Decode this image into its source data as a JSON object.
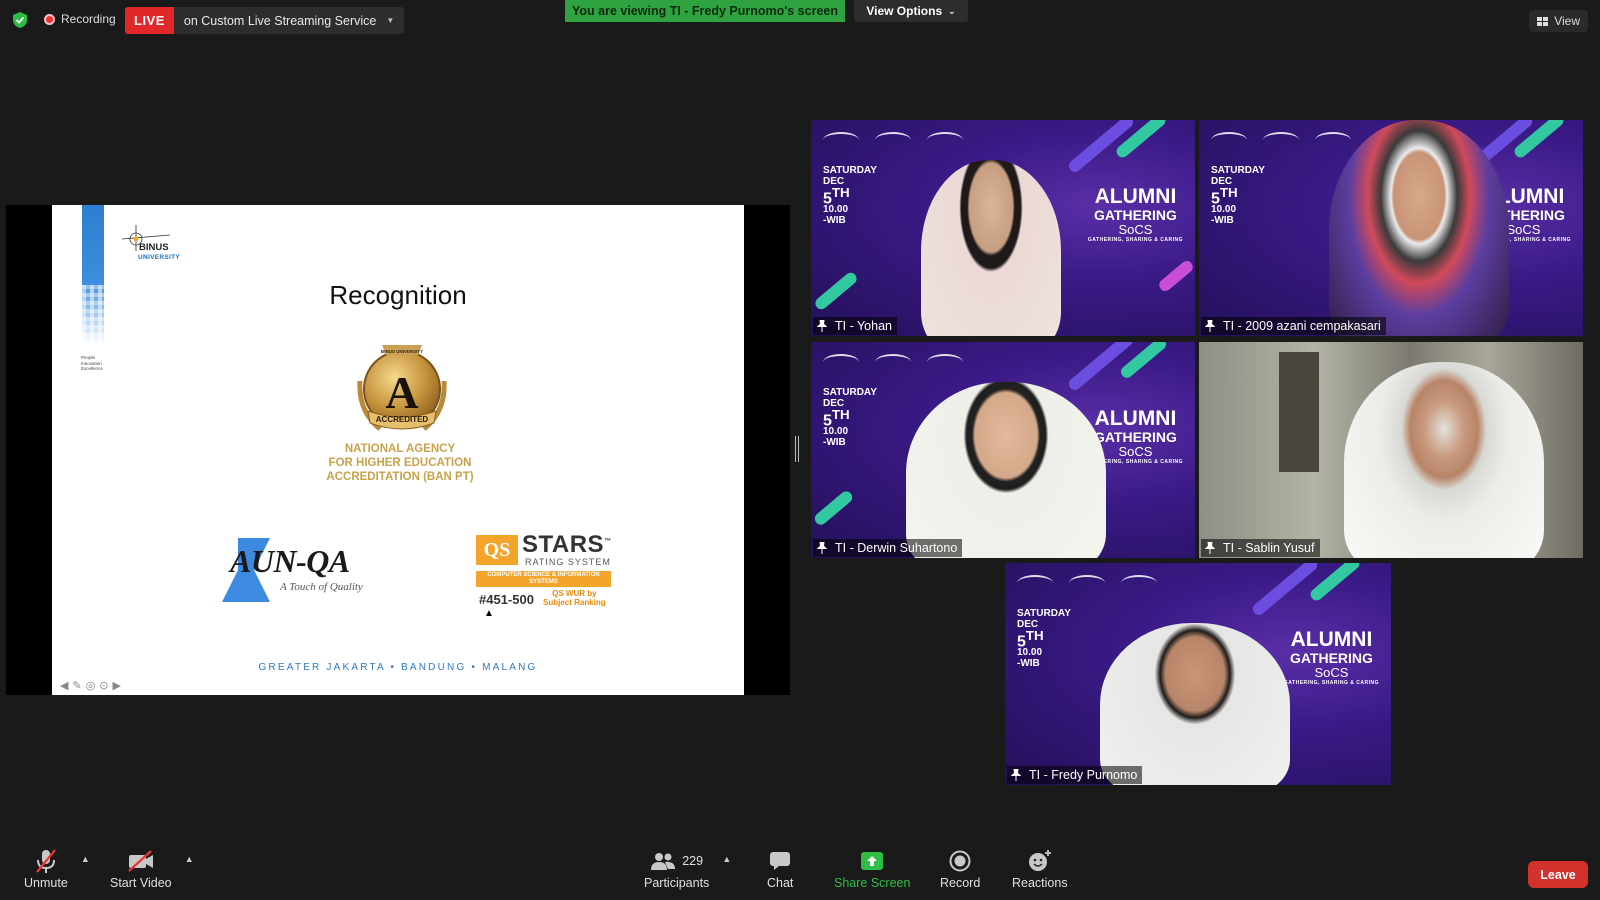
{
  "topbar": {
    "recording_label": "Recording",
    "live_badge": "LIVE",
    "live_service": "on Custom Live Streaming Service",
    "viewing_banner": "You are viewing TI - Fredy Purnomo's screen",
    "view_options": "View Options",
    "view_label": "View"
  },
  "slide": {
    "title": "Recognition",
    "brand": "BINUS",
    "brand_sub": "UNIVERSITY",
    "people_tag": [
      "People",
      "Innovation",
      "Excellence"
    ],
    "badge_letter": "A",
    "badge_top": "BINUS UNIVERSITY",
    "badge_ribbon": "ACCREDITED",
    "ban_pt": [
      "NATIONAL AGENCY",
      "FOR HIGHER EDUCATION",
      "ACCREDITATION (BAN PT)"
    ],
    "aun_main": "AUN-QA",
    "aun_tag": "A Touch of Quality",
    "qs_logo": "QS",
    "qs_stars": "STARS",
    "qs_tm": "™",
    "qs_rating": "RATING SYSTEM",
    "qs_band": "COMPUTER SCIENCE & INFORMATION SYSTEMS",
    "qs_rank": "#451-500",
    "qs_wur": [
      "QS WUR by",
      "Subject Ranking"
    ],
    "campus": "GREATER JAKARTA • BANDUNG • MALANG"
  },
  "event_banner": {
    "day": "SATURDAY",
    "month": "DEC",
    "date": "5",
    "date_suffix": "TH",
    "time": "10.00",
    "tz": "-WIB",
    "title1": "ALUMNI",
    "title2": "GATHERING",
    "title3": "SoCS",
    "tagline": "GATHERING, SHARING & CARING"
  },
  "participants_tiles": [
    {
      "name": "TI - Yohan"
    },
    {
      "name": "TI - 2009 azani cempakasari"
    },
    {
      "name": "TI - Derwin Suhartono"
    },
    {
      "name": "TI - Sablin Yusuf"
    },
    {
      "name": "TI - Fredy Purnomo"
    }
  ],
  "toolbar": {
    "unmute": "Unmute",
    "start_video": "Start Video",
    "participants": "Participants",
    "participants_count": "229",
    "chat": "Chat",
    "share_screen": "Share Screen",
    "record": "Record",
    "reactions": "Reactions",
    "leave": "Leave"
  },
  "colors": {
    "live_red": "#e02828",
    "viewing_green": "#2fa33f",
    "share_green": "#2fbd45",
    "leave_red": "#d3312b",
    "active_speaker": "#e6e87c"
  }
}
